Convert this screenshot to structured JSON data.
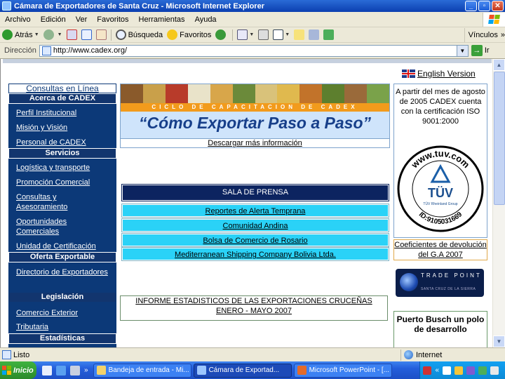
{
  "window": {
    "title": "Cámara de Exportadores de Santa Cruz - Microsoft Internet Explorer",
    "min_glyph": "_",
    "max_glyph": "▫",
    "close_glyph": "✕"
  },
  "menu": {
    "items": [
      "Archivo",
      "Edición",
      "Ver",
      "Favoritos",
      "Herramientas",
      "Ayuda"
    ]
  },
  "toolbar": {
    "back_label": "Atrás",
    "search_label": "Búsqueda",
    "favorites_label": "Favoritos",
    "links_label": "Vínculos",
    "links_chevron": "»"
  },
  "address": {
    "label": "Dirección",
    "url": "http://www.cadex.org/",
    "go_label": "Ir"
  },
  "page": {
    "english_link": "English Version",
    "sidebar": {
      "consultas": "Consultas en Línea",
      "section_acerca": "Acerca de CADEX",
      "acerca_items": [
        "Perfil Institucional",
        "Misión y Visión",
        "Personal de CADEX"
      ],
      "section_servicios": "Servicios",
      "servicios_items": [
        "Logística y transporte",
        "Promoción Comercial",
        "Consultas y Asesoramiento",
        "Oportunidades Comerciales",
        "Unidad de Certificación"
      ],
      "section_oferta": "Oferta Exportable",
      "oferta_items": [
        "Directorio de Exportadores"
      ],
      "section_legislacion": "Legislación",
      "legislacion_items": [
        "Comercio Exterior",
        "Tributaria"
      ],
      "section_estadisticas": "Estadísticas"
    },
    "banner": {
      "stripe": "CICLO DE CAPACITACION DE CADEX",
      "title": "“Cómo Exportar Paso a Paso”",
      "download_link": "Descargar más información"
    },
    "press": {
      "heading": "SALA DE PRENSA",
      "links": [
        "Reportes de Alerta Temprana",
        "Comunidad Andina",
        "Bolsa de Comercio de Rosario",
        "Mediterranean Shipping Company Bolivia Ltda."
      ]
    },
    "report": {
      "line1": "INFORME ESTADISTICOS DE LAS EXPORTACIONES CRUCEÑAS",
      "line2": "ENERO - MAYO 2007"
    },
    "certification": {
      "text": "A partir del mes de agosto de 2005 CADEX cuenta con la certificación ISO 9001:2000",
      "seal_url": "www.tuv.com",
      "seal_mark": "TÜV",
      "seal_group": "TÜV Rheinland Group",
      "seal_id": "ID:9105031669",
      "refund_link": "Coeficientes de devolución del G.A 2007"
    },
    "tradepoint": {
      "name": "TRADE POINT",
      "sub": "SANTA CRUZ DE LA SIERRA"
    },
    "puerto_busch": "Puerto Busch un polo de desarrollo"
  },
  "status": {
    "text": "Listo",
    "zone": "Internet"
  },
  "taskbar": {
    "start": "Inicio",
    "ql_more": "»",
    "tasks": [
      "Bandeja de entrada - Mi...",
      "Cámara de Exportad...",
      "Microsoft PowerPoint - [..."
    ],
    "tray_chevron": "«"
  },
  "colors": {
    "sidebar_bg": "#0c3978",
    "press_head_bg": "#0c2460",
    "press_row_bg": "#2ad2f7",
    "banner_stripe": "#f29b1c"
  }
}
